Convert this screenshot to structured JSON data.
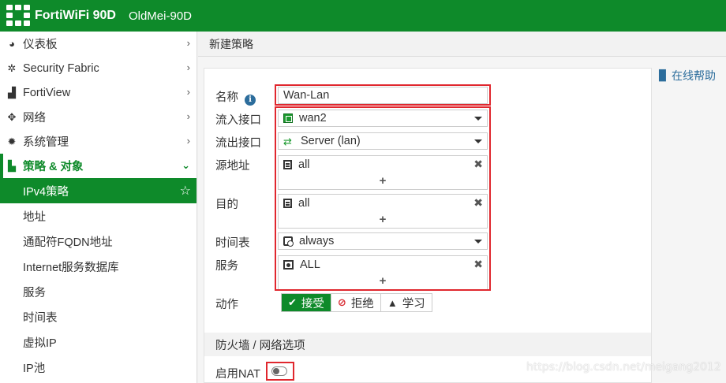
{
  "header": {
    "brand": "FortiWiFi 90D",
    "hostname": "OldMei-90D"
  },
  "sidebar": {
    "items": [
      {
        "label": "仪表板",
        "icon": "dashboard-icon"
      },
      {
        "label": "Security Fabric",
        "icon": "security-fabric-icon"
      },
      {
        "label": "FortiView",
        "icon": "fortiview-chart-icon"
      },
      {
        "label": "网络",
        "icon": "network-arrows-icon"
      },
      {
        "label": "系统管理",
        "icon": "gear-icon"
      },
      {
        "label": "策略 & 对象",
        "icon": "policy-objects-icon",
        "expanded": true
      }
    ],
    "sub_items": [
      {
        "label": "IPv4策略",
        "active": true
      },
      {
        "label": "地址"
      },
      {
        "label": "通配符FQDN地址"
      },
      {
        "label": "Internet服务数据库"
      },
      {
        "label": "服务"
      },
      {
        "label": "时间表"
      },
      {
        "label": "虚拟IP"
      },
      {
        "label": "IP池"
      }
    ]
  },
  "main": {
    "page_title": "新建策略",
    "help_link": "在线帮助",
    "form": {
      "name_label": "名称",
      "name_value": "Wan-Lan",
      "incoming_label": "流入接口",
      "incoming_value": "wan2",
      "outgoing_label": "流出接口",
      "outgoing_value": "Server (lan)",
      "source_label": "源地址",
      "source_value": "all",
      "dest_label": "目的",
      "dest_value": "all",
      "schedule_label": "时间表",
      "schedule_value": "always",
      "service_label": "服务",
      "service_value": "ALL",
      "add_symbol": "+",
      "remove_symbol": "✖",
      "action_label": "动作",
      "actions": [
        {
          "label": "接受",
          "selected": true
        },
        {
          "label": "拒绝",
          "selected": false
        },
        {
          "label": "学习",
          "selected": false
        }
      ],
      "section_title": "防火墙 / 网络选项",
      "nat_label": "启用NAT",
      "nat_enabled": false
    }
  },
  "watermark": "https://blog.csdn.net/meigang2012",
  "colors": {
    "brand_green": "#0e8a2a",
    "highlight_red": "#e0272e",
    "link_blue": "#2c6d9c"
  }
}
